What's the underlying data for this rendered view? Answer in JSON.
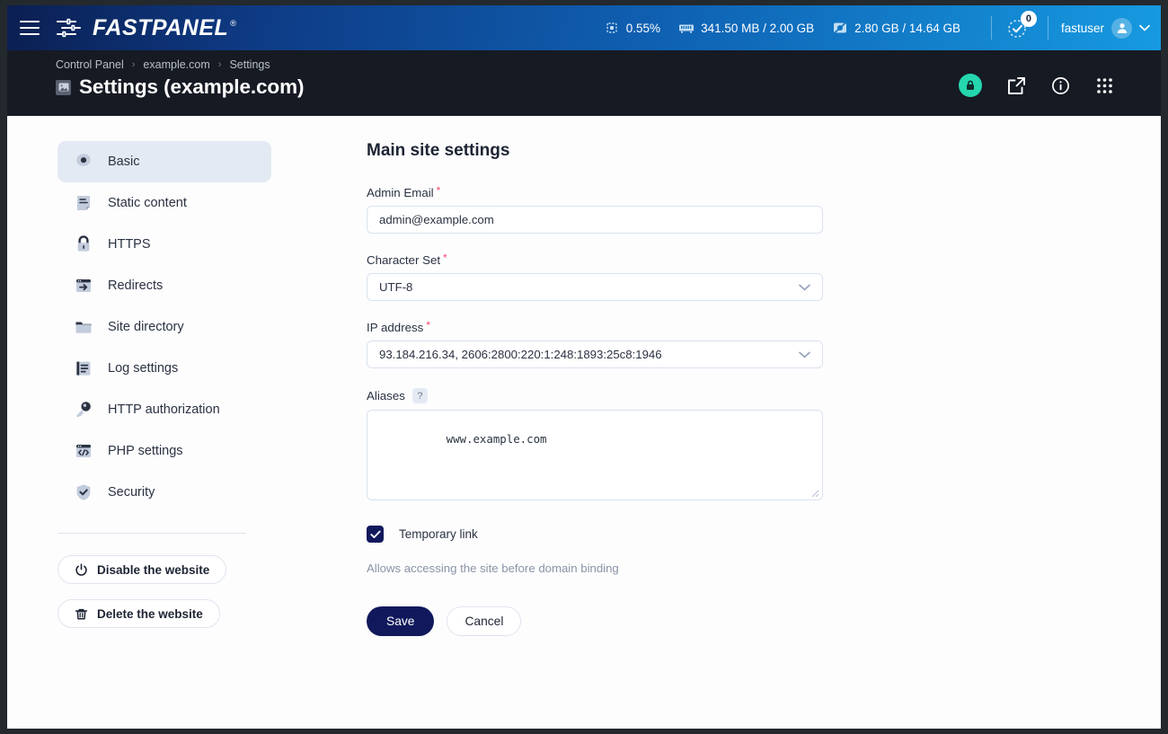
{
  "topbar": {
    "menu_icon": "hamburger-icon",
    "brand": "FASTPANEL",
    "brand_registered": "®",
    "stats": [
      {
        "icon": "cpu-icon",
        "value": "0.55%"
      },
      {
        "icon": "ram-icon",
        "value": "341.50 MB / 2.00 GB"
      },
      {
        "icon": "disk-icon",
        "value": "2.80 GB / 14.64 GB"
      }
    ],
    "notifications": {
      "icon": "task-check-icon",
      "count": "0"
    },
    "user": {
      "name": "fastuser",
      "avatar_icon": "user-avatar-icon",
      "caret_icon": "chevron-down-icon"
    }
  },
  "pagehead": {
    "breadcrumb": [
      {
        "label": "Control Panel",
        "current": false
      },
      {
        "label": "example.com",
        "current": false
      },
      {
        "label": "Settings",
        "current": true
      }
    ],
    "separator": "›",
    "title_icon": "image-placeholder-icon",
    "title": "Settings (example.com)",
    "actions": [
      {
        "icon": "lock-badge-icon",
        "color": "#25d6ae"
      },
      {
        "icon": "external-link-icon",
        "color": "#ffffff"
      },
      {
        "icon": "info-circle-icon",
        "color": "#ffffff"
      },
      {
        "icon": "apps-grid-icon",
        "color": "#ffffff"
      }
    ]
  },
  "sidebar": {
    "items": [
      {
        "label": "Basic",
        "icon": "gear-icon",
        "active": true
      },
      {
        "label": "Static content",
        "icon": "document-icon",
        "active": false
      },
      {
        "label": "HTTPS",
        "icon": "padlock-icon",
        "active": false
      },
      {
        "label": "Redirects",
        "icon": "redirect-icon",
        "active": false
      },
      {
        "label": "Site directory",
        "icon": "folder-icon",
        "active": false
      },
      {
        "label": "Log settings",
        "icon": "log-list-icon",
        "active": false
      },
      {
        "label": "HTTP authorization",
        "icon": "key-icon",
        "active": false
      },
      {
        "label": "PHP settings",
        "icon": "code-window-icon",
        "active": false
      },
      {
        "label": "Security",
        "icon": "shield-check-icon",
        "active": false
      }
    ],
    "disable_button": {
      "label": "Disable the website",
      "icon": "power-icon"
    },
    "delete_button": {
      "label": "Delete the website",
      "icon": "trash-icon"
    }
  },
  "main": {
    "section_title": "Main site settings",
    "fields": {
      "admin_email": {
        "label": "Admin Email",
        "required": true,
        "value": "admin@example.com",
        "placeholder": "Admin Email"
      },
      "character_set": {
        "label": "Character Set",
        "required": true,
        "value": "UTF-8",
        "caret_icon": "chevron-down-icon",
        "options": [
          "UTF-8"
        ]
      },
      "ip_address": {
        "label": "IP address",
        "required": true,
        "value": "93.184.216.34, 2606:2800:220:1:248:1893:25c8:1946",
        "caret_icon": "chevron-down-icon",
        "options": [
          "93.184.216.34, 2606:2800:220:1:248:1893:25c8:1946"
        ]
      },
      "aliases": {
        "label": "Aliases",
        "required": false,
        "help_icon": "question-mark-icon",
        "help_label": "?",
        "value": "www.example.com",
        "placeholder": "www.example.com"
      },
      "temporary_link": {
        "label": "Temporary link",
        "checked": true,
        "hint": "Allows accessing the site before domain binding"
      }
    },
    "save_label": "Save",
    "cancel_label": "Cancel"
  },
  "colors": {
    "brand_blue_dark": "#0b1f52",
    "brand_blue_light": "#169ae0",
    "header_dark": "#161a23",
    "navy": "#11195c",
    "teal": "#25d6ae",
    "required_red": "#f4476b",
    "active_nav_bg": "#e4eaf3"
  }
}
